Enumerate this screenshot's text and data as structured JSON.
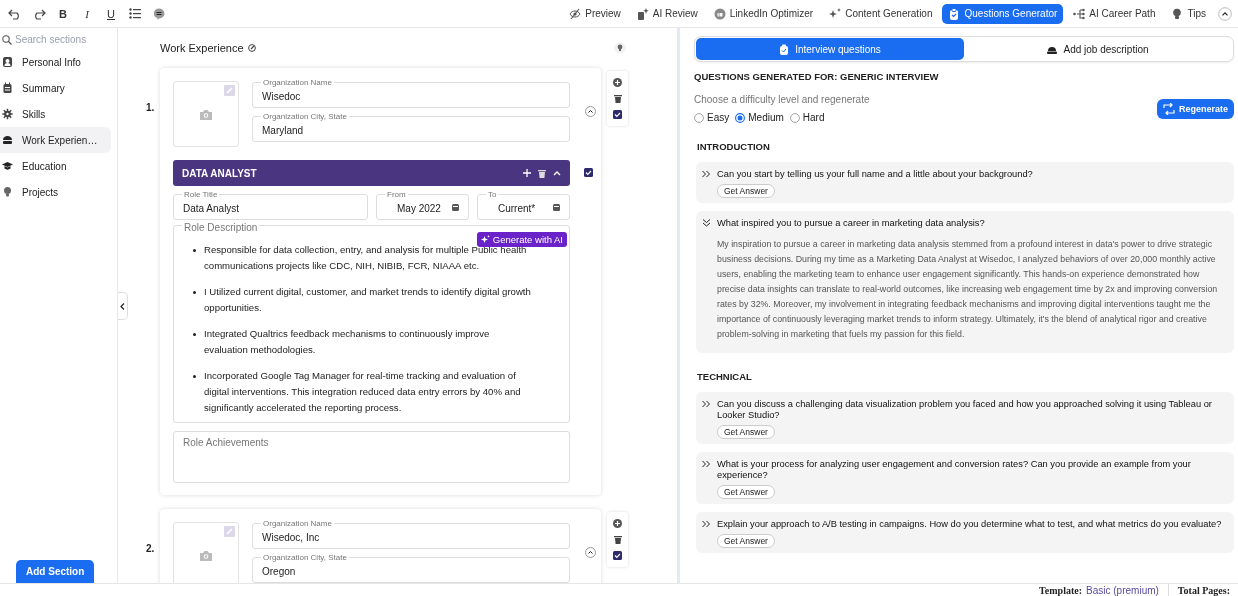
{
  "toolbar": {
    "format_buttons": [
      {
        "label": "B",
        "kind": "bold"
      },
      {
        "label": "I",
        "kind": "italic"
      },
      {
        "label": "U",
        "kind": "underline"
      }
    ]
  },
  "nav_tabs": [
    {
      "label": "Preview",
      "selected": false
    },
    {
      "label": "AI Review",
      "selected": false
    },
    {
      "label": "LinkedIn Optimizer",
      "selected": false
    },
    {
      "label": "Content Generation",
      "selected": false
    },
    {
      "label": "Questions Generator",
      "selected": true
    },
    {
      "label": "AI Career Path",
      "selected": false
    },
    {
      "label": "Tips",
      "selected": false
    }
  ],
  "sidebar": {
    "search": {
      "placeholder": "Search sections"
    },
    "items": [
      {
        "label": "Personal Info",
        "selected": false
      },
      {
        "label": "Summary",
        "selected": false
      },
      {
        "label": "Skills",
        "selected": false
      },
      {
        "label": "Work Experien…",
        "selected": true
      },
      {
        "label": "Education",
        "selected": false
      },
      {
        "label": "Projects",
        "selected": false
      }
    ],
    "add_button": "Add Section"
  },
  "editor": {
    "title": "Work Experience",
    "entries": [
      {
        "number": "1.",
        "org_name": {
          "label": "Organization Name",
          "value": "Wisedoc"
        },
        "org_city": {
          "label": "Organization City, State",
          "value": "Maryland"
        },
        "visible": true,
        "roles": [
          {
            "header": "DATA ANALYST",
            "visible": true,
            "title": {
              "label": "Role Title",
              "value": "Data Analyst"
            },
            "from": {
              "label": "From",
              "value": "May 2022"
            },
            "to": {
              "label": "To",
              "value": "Current*"
            },
            "description": {
              "label": "Role Description",
              "ai_button": "Generate with AI",
              "bullets": [
                "Responsible for data collection, entry, and analysis for multiple Public health communications projects like CDC, NIH, NIBIB, FCR, NIAAA etc.",
                "I Utilized current digital, customer, and market trends to identify digital growth opportunities.",
                "Integrated Qualtrics feedback mechanisms to continuously improve evaluation methodologies.",
                "Incorporated Google Tag Manager for real-time tracking and evaluation of digital interventions. This integration reduced data entry errors by 40% and significantly accelerated the reporting process."
              ]
            },
            "achievements": {
              "placeholder": "Role Achievements"
            }
          }
        ]
      },
      {
        "number": "2.",
        "org_name": {
          "label": "Organization Name",
          "value": "Wisedoc, Inc"
        },
        "org_city": {
          "label": "Organization City, State",
          "value": "Oregon"
        },
        "visible": true
      }
    ]
  },
  "questions_panel": {
    "tabs": [
      {
        "label": "Interview questions",
        "selected": true
      },
      {
        "label": "Add job description",
        "selected": false
      }
    ],
    "heading": "QUESTIONS GENERATED FOR: GENERIC INTERVIEW",
    "hint": "Choose a difficulty level and regenerate",
    "difficulties": [
      {
        "label": "Easy",
        "selected": false
      },
      {
        "label": "Medium",
        "selected": true
      },
      {
        "label": "Hard",
        "selected": false
      }
    ],
    "regenerate_button": "Regenerate",
    "sections": [
      {
        "title": "INTRODUCTION",
        "questions": [
          {
            "text": "Can you start by telling us your full name and a little about your background?",
            "expanded": false,
            "button": "Get Answer"
          },
          {
            "text": "What inspired you to pursue a career in marketing data analysis?",
            "expanded": true,
            "answer": "My inspiration to pursue a career in marketing data analysis stemmed from a profound interest in data's power to drive strategic business decisions. During my time as a Marketing Data Analyst at Wisedoc, I analyzed behaviors of over 20,000 monthly active users, enabling the marketing team to enhance user engagement significantly. This hands-on experience demonstrated how precise data insights can translate to real-world outcomes, like increasing web engagement time by 2x and improving conversion rates by 32%. Moreover, my involvement in integrating feedback mechanisms and improving digital interventions taught me the importance of continuously leveraging market trends to inform strategy. Ultimately, it's the blend of analytical rigor and creative problem-solving in marketing that fuels my passion for this field."
          }
        ]
      },
      {
        "title": "TECHNICAL",
        "questions": [
          {
            "text": "Can you discuss a challenging data visualization problem you faced and how you approached solving it using Tableau or Looker Studio?",
            "expanded": false,
            "button": "Get Answer"
          },
          {
            "text": "What is your process for analyzing user engagement and conversion rates? Can you provide an example from your experience?",
            "expanded": false,
            "button": "Get Answer"
          },
          {
            "text": "Explain your approach to A/B testing in campaigns. How do you determine what to test, and what metrics do you evaluate?",
            "expanded": false,
            "button": "Get Answer"
          }
        ]
      }
    ]
  },
  "footer": {
    "template_label": "Template:",
    "template_value": "Basic (premium)",
    "pages_label": "Total Pages:"
  }
}
